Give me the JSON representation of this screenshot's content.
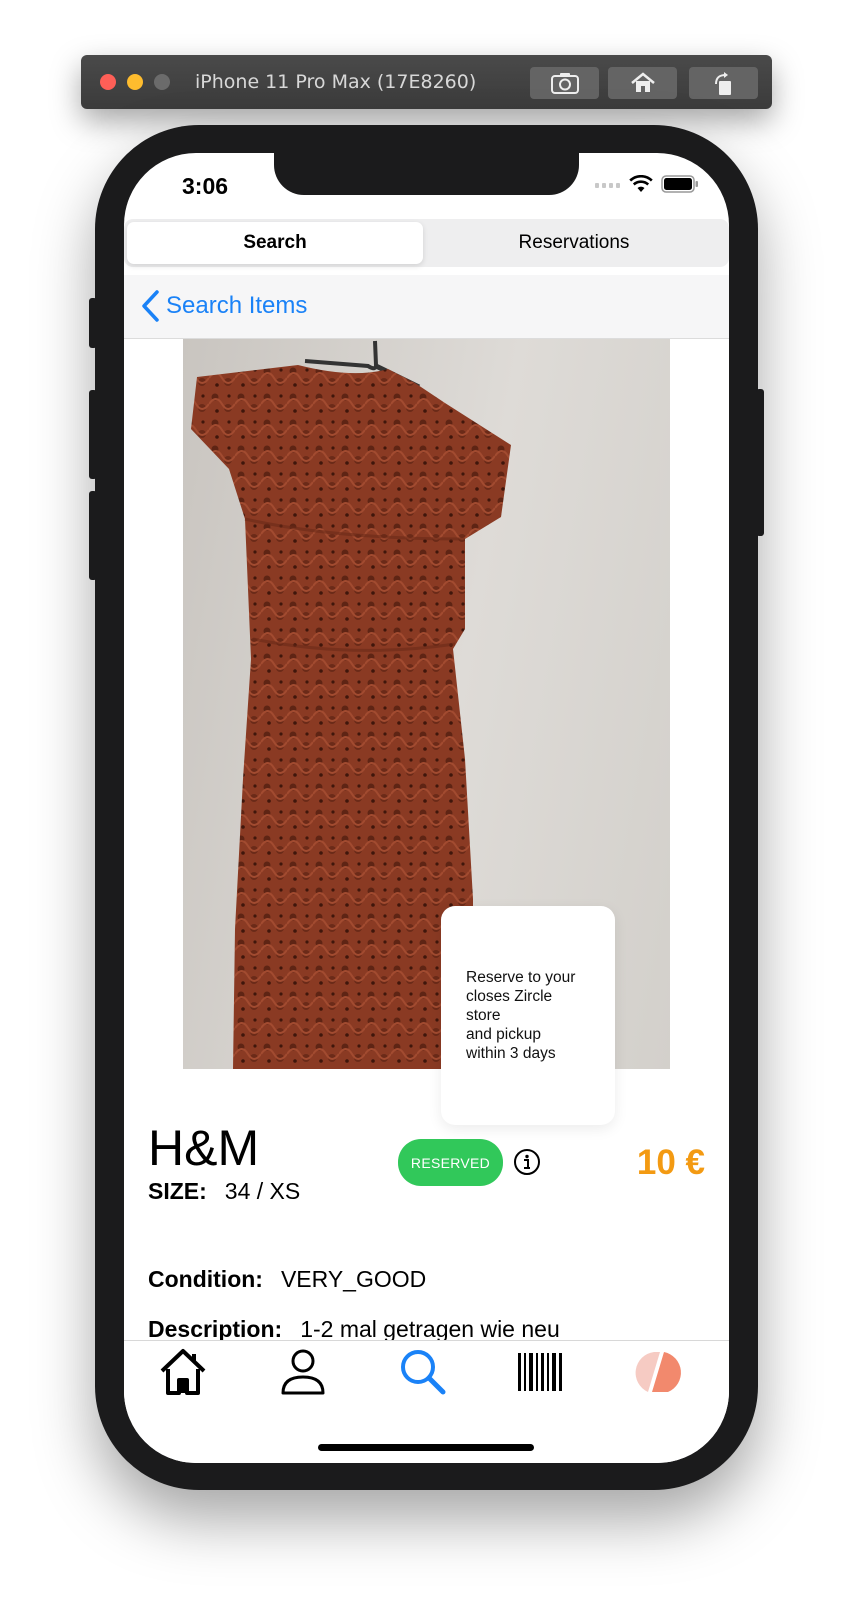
{
  "simulator": {
    "title": "iPhone 11 Pro Max (17E8260)",
    "buttons": [
      "screenshot-icon",
      "home-icon",
      "rotate-icon"
    ]
  },
  "status_bar": {
    "time": "3:06",
    "icons": [
      "cellular-icon",
      "wifi-icon",
      "battery-icon"
    ]
  },
  "segmented_control": {
    "tabs": [
      {
        "label": "Search",
        "selected": true
      },
      {
        "label": "Reservations",
        "selected": false
      }
    ]
  },
  "nav": {
    "back_label": "Search Items"
  },
  "product": {
    "brand": "H&M",
    "size_label": "SIZE:",
    "size_value": "34 / XS",
    "status_badge": "RESERVED",
    "price": "10 €",
    "condition_label": "Condition:",
    "condition_value": "VERY_GOOD",
    "description_label": "Description:",
    "description_value": "1-2 mal getragen wie neu",
    "image": "red-lace-dress-photo"
  },
  "tooltip": {
    "text": "Reserve to your\ncloses Zircle\nstore\nand pickup\nwithin 3 days"
  },
  "tab_bar": {
    "items": [
      {
        "icon": "home-icon",
        "active": false
      },
      {
        "icon": "profile-icon",
        "active": false
      },
      {
        "icon": "search-icon",
        "active": true
      },
      {
        "icon": "barcode-icon",
        "active": false
      },
      {
        "icon": "zircle-logo-icon",
        "active": false
      }
    ]
  },
  "colors": {
    "accent": "#1a82f7",
    "reserved_green": "#31c85a",
    "price_orange": "#f39a12",
    "dress": "#8a3a23"
  }
}
